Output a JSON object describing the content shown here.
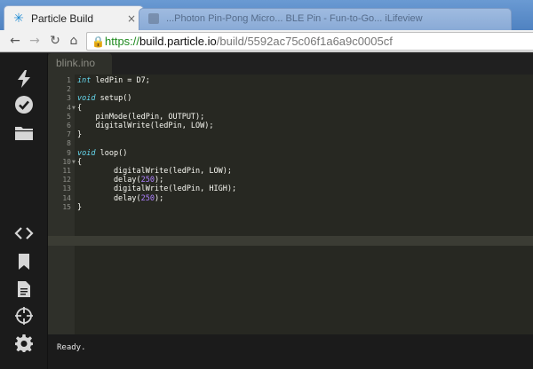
{
  "browser": {
    "tabs": [
      {
        "title": "Particle Build",
        "close_glyph": "×",
        "active": true
      },
      {
        "title": "...Photon Pin-Pong Micro...  BLE Pin - Fun-to-Go...  iLifeview",
        "active": false
      }
    ],
    "address": {
      "scheme": "https://",
      "host": "build.particle.io",
      "path": "/build/5592ac75c06f1a6a9c0005cf"
    },
    "icons": [
      "back-icon",
      "forward-icon",
      "reload-icon",
      "home-icon",
      "lock-icon",
      "particle-logo-icon"
    ]
  },
  "sidebar": {
    "icons": [
      "flash-icon",
      "verify-icon",
      "folder-icon",
      "code-icon",
      "bookmark-icon",
      "document-icon",
      "crosshair-icon",
      "gear-icon"
    ]
  },
  "editor": {
    "file_tab": "blink.ino",
    "current_line": 15,
    "lines": [
      {
        "n": "1",
        "fold": false,
        "tokens": [
          [
            "kw",
            "int"
          ],
          [
            "txt",
            " ledPin = D7;"
          ]
        ]
      },
      {
        "n": "2",
        "fold": false,
        "tokens": []
      },
      {
        "n": "3",
        "fold": false,
        "tokens": [
          [
            "kw",
            "void"
          ],
          [
            "txt",
            " setup()"
          ]
        ]
      },
      {
        "n": "4",
        "fold": true,
        "tokens": [
          [
            "txt",
            "{"
          ]
        ]
      },
      {
        "n": "5",
        "fold": false,
        "tokens": [
          [
            "txt",
            "    pinMode(ledPin, OUTPUT);"
          ]
        ]
      },
      {
        "n": "6",
        "fold": false,
        "tokens": [
          [
            "txt",
            "    digitalWrite(ledPin, LOW);"
          ]
        ]
      },
      {
        "n": "7",
        "fold": false,
        "tokens": [
          [
            "txt",
            "}"
          ]
        ]
      },
      {
        "n": "8",
        "fold": false,
        "tokens": []
      },
      {
        "n": "9",
        "fold": false,
        "tokens": [
          [
            "kw",
            "void"
          ],
          [
            "txt",
            " loop()"
          ]
        ]
      },
      {
        "n": "10",
        "fold": true,
        "tokens": [
          [
            "txt",
            "{"
          ]
        ]
      },
      {
        "n": "11",
        "fold": false,
        "tokens": [
          [
            "txt",
            "        digitalWrite(ledPin, LOW);"
          ]
        ]
      },
      {
        "n": "12",
        "fold": false,
        "tokens": [
          [
            "txt",
            "        delay("
          ],
          [
            "num",
            "250"
          ],
          [
            "txt",
            ");"
          ]
        ]
      },
      {
        "n": "13",
        "fold": false,
        "tokens": [
          [
            "txt",
            "        digitalWrite(ledPin, HIGH);"
          ]
        ]
      },
      {
        "n": "14",
        "fold": false,
        "tokens": [
          [
            "txt",
            "        delay("
          ],
          [
            "num",
            "250"
          ],
          [
            "txt",
            ");"
          ]
        ]
      },
      {
        "n": "15",
        "fold": false,
        "tokens": [
          [
            "txt",
            "}"
          ]
        ]
      }
    ]
  },
  "console": {
    "status": "Ready."
  },
  "colors": {
    "keyword": "#66d9ef",
    "number": "#ae81ff",
    "text": "#f8f8f2",
    "gutter_text": "#8f908a",
    "editor_bg": "#272822"
  }
}
